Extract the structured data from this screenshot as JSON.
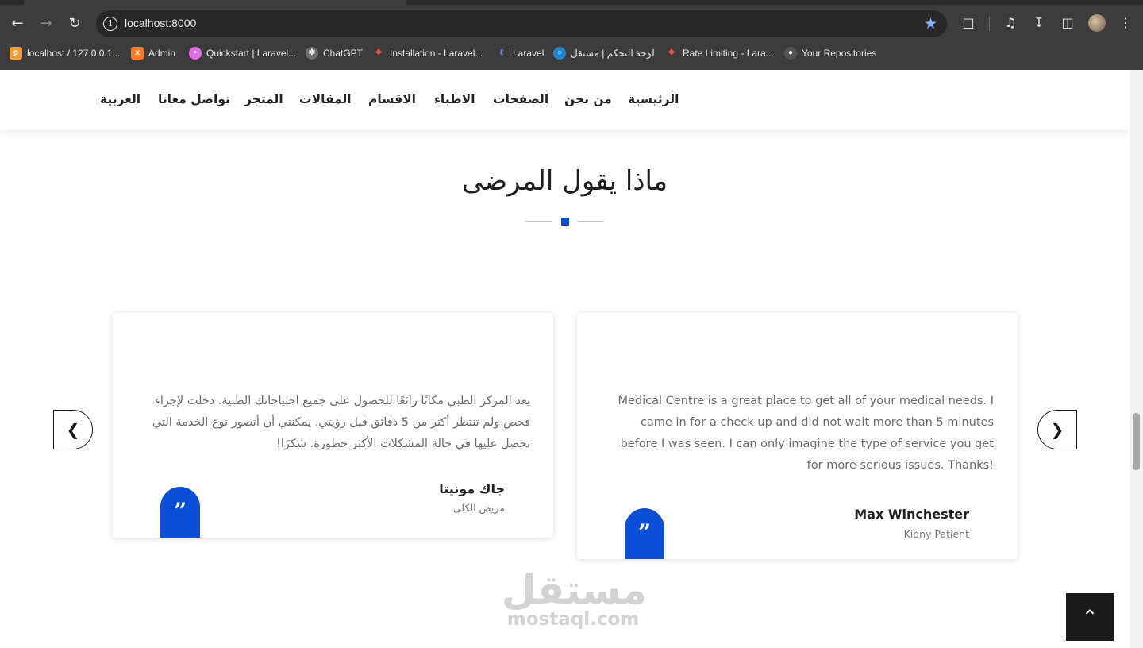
{
  "browser": {
    "url": "localhost:8000",
    "bookmarks": [
      {
        "label": "localhost / 127.0.0.1...",
        "icon": "phpmyadmin-icon",
        "color": "#f0a030"
      },
      {
        "label": "Admin",
        "icon": "xampp-icon",
        "color": "#fb7a24"
      },
      {
        "label": "Quickstart | Laravel...",
        "icon": "livewire-icon",
        "color": "#e26ee7"
      },
      {
        "label": "ChatGPT",
        "icon": "chatgpt-icon",
        "color": "#9aa0a6"
      },
      {
        "label": "Installation - Laravel...",
        "icon": "laravel-icon",
        "color": "#f55247"
      },
      {
        "label": "Laravel",
        "icon": "laravel-ide-icon",
        "color": "#5c8dd6"
      },
      {
        "label": "لوحة التحكم | مستقل",
        "icon": "mostaql-icon",
        "color": "#2386c8"
      },
      {
        "label": "Rate Limiting - Lara...",
        "icon": "laravel-icon",
        "color": "#f55247"
      },
      {
        "label": "Your Repositories",
        "icon": "github-icon",
        "color": "#9aa0a6"
      }
    ]
  },
  "site_nav": {
    "items": [
      "الرئيسية",
      "من نحن",
      "الصفحات",
      "الاطباء",
      "الاقسام",
      "المقالات",
      "المتجر",
      "تواصل معانا",
      "العربية"
    ]
  },
  "section": {
    "title": "ماذا يقول المرضى",
    "accent_color": "#0b4fd9"
  },
  "testimonials": [
    {
      "text": "يعد المركز الطبي مكانًا رائعًا للحصول على جميع احتياجاتك الطبية. دخلت لإجراء فحص ولم تنتظر أكثر من 5 دقائق قبل رؤيتي. يمكنني أن أتصور نوع الخدمة التي تحصل عليها في حالة المشكلات الأكثر خطورة. شكرًا!",
      "name": "جاك مونيتا",
      "role": "مريض الكلى",
      "quote_mark": "”"
    },
    {
      "text": "Medical Centre is a great place to get all of your medical needs. I came in for a check up and did not wait more than 5 minutes before I was seen. I can only imagine the type of service you get for more serious issues. Thanks!",
      "name": "Max Winchester",
      "role": "Kidny Patient",
      "quote_mark": "”"
    }
  ],
  "carousel": {
    "prev_icon": "chevron-left-icon",
    "next_icon": "chevron-right-icon"
  },
  "watermark": {
    "arabic": "مستقل",
    "latin": "mostaql.com"
  },
  "back_to_top": {
    "icon": "chevron-up-icon"
  }
}
